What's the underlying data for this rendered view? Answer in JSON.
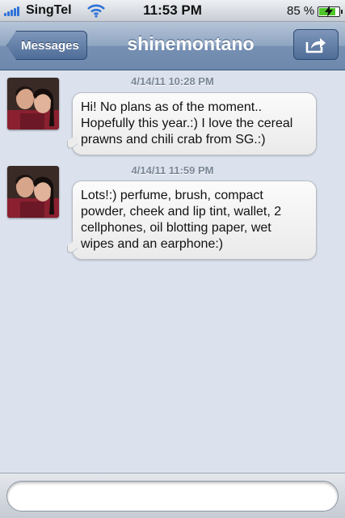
{
  "status_bar": {
    "carrier": "SingTel",
    "time": "11:53 PM",
    "battery_percent": "85 %",
    "battery_level": 0.85,
    "signal_bars": 5
  },
  "nav": {
    "back_label": "Messages",
    "title": "shinemontano",
    "action_icon": "share-arrow-icon"
  },
  "messages": [
    {
      "timestamp": "4/14/11 10:28 PM",
      "text": "Hi! No plans as of the moment.. Hopefully this year.:) I love the cereal prawns and chili crab from SG.:)"
    },
    {
      "timestamp": "4/14/11 11:59 PM",
      "text": "Lots!:) perfume, brush, compact powder, cheek and lip tint, wallet, 2 cellphones, oil blotting paper, wet wipes and an earphone:)"
    }
  ],
  "input": {
    "value": "",
    "placeholder": ""
  },
  "colors": {
    "nav_accent": "#6e88ad",
    "background": "#dbe2ed",
    "signal": "#2f72d8",
    "battery": "#4fc629"
  }
}
